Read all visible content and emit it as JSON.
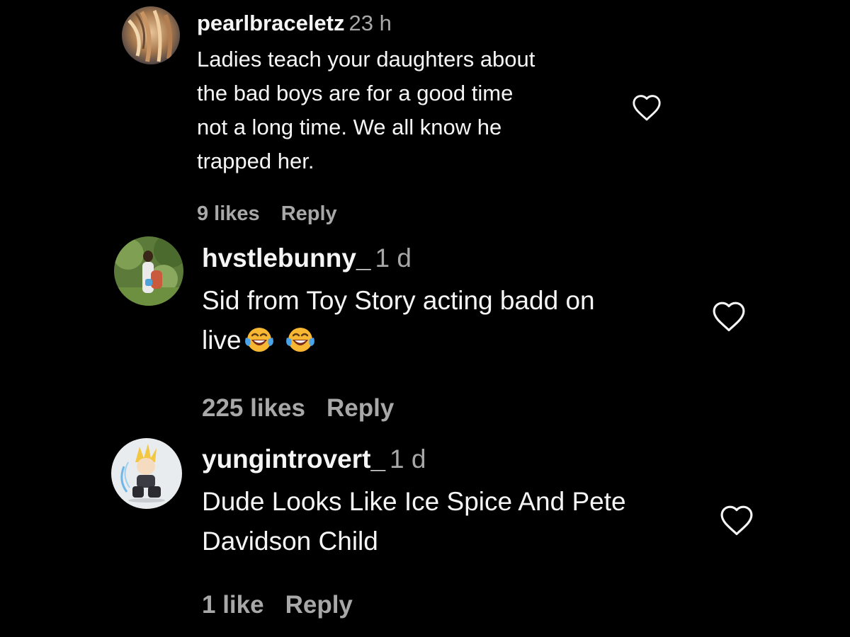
{
  "comments": [
    {
      "username": "pearlbraceletz",
      "time": "23 h",
      "text_lines": [
        "Ladies teach your daughters about",
        "the bad boys are for a good time",
        "not a long time. We all know he",
        "trapped her."
      ],
      "likes": "9 likes",
      "reply": "Reply",
      "avatar_icon": "avatar-blonde-hair-photo",
      "like_icon": "heart-outline-icon"
    },
    {
      "username": "hvstlebunny_",
      "time": "1 d",
      "text_lines": [
        "Sid from Toy Story acting badd on",
        "live"
      ],
      "emojis": [
        "face-with-tears-of-joy",
        "face-with-tears-of-joy"
      ],
      "likes": "225 likes",
      "reply": "Reply",
      "avatar_icon": "avatar-person-outdoors-photo",
      "like_icon": "heart-outline-icon"
    },
    {
      "username": "yungintrovert_",
      "time": "1 d",
      "text_lines": [
        "Dude Looks Like Ice Spice And Pete",
        "Davidson Child"
      ],
      "likes": "1 like",
      "reply": "Reply",
      "avatar_icon": "avatar-anime-character-drawing",
      "like_icon": "heart-outline-icon"
    }
  ],
  "colors": {
    "background": "#000000",
    "primary_text": "#f5f5f5",
    "secondary_text": "#a8a8a8"
  }
}
